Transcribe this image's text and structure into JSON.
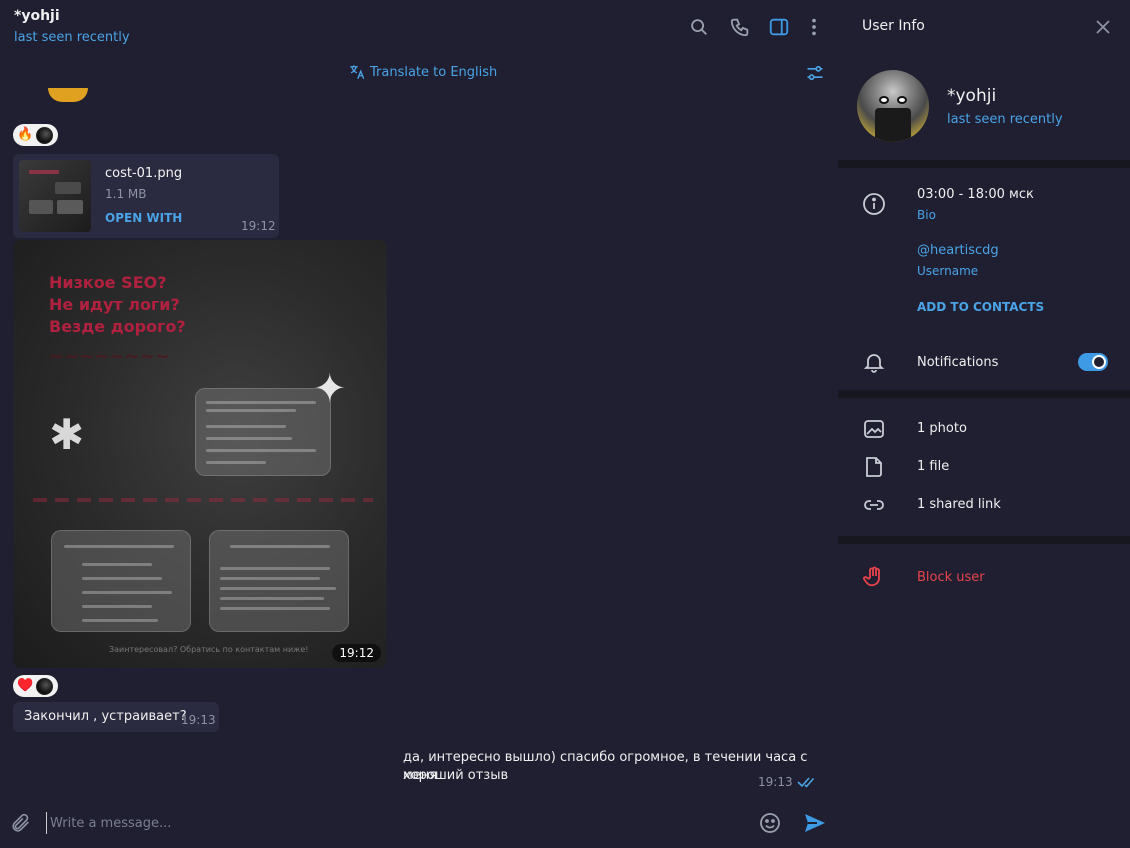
{
  "chat": {
    "title": "*yohji",
    "status": "last seen recently",
    "translate_label": "Translate to English",
    "header_icons": [
      "search-icon",
      "phone-icon",
      "sidebar-toggle-icon",
      "more-vertical-icon"
    ]
  },
  "messages": {
    "reaction1_emoji": "🔥",
    "file": {
      "name": "cost-01.png",
      "size": "1.1 MB",
      "action": "OPEN WITH",
      "time": "19:12"
    },
    "photo": {
      "time": "19:12",
      "headline": "Низкое SEO?\nНе идут логи?\nВезде дорого?",
      "footer": "Заинтересовал? Обратись по контактам ниже!"
    },
    "reaction2_emoji": "♥️",
    "incoming_text": "Закончил , устраивает?",
    "incoming_time": "19:13",
    "outgoing_text_line1": "да, интересно вышло) спасибо огромное, в течении часа с меня",
    "outgoing_text_line2": "хороший отзыв",
    "outgoing_time": "19:13"
  },
  "composer": {
    "placeholder": "Write a message..."
  },
  "info": {
    "title": "User Info",
    "name": "*yohji",
    "status": "last seen recently",
    "bio_value": "03:00 - 18:00 мск",
    "bio_label": "Bio",
    "username_value": "@heartiscdg",
    "username_label": "Username",
    "add_contacts": "ADD TO CONTACTS",
    "notifications_label": "Notifications",
    "notifications_on": true,
    "media_photos": "1 photo",
    "media_files": "1 file",
    "media_links": "1 shared link",
    "block_label": "Block user"
  },
  "colors": {
    "accent": "#4aa3e6",
    "danger": "#e8434c",
    "chat_bg": "#1f1f31",
    "bubble": "#2a2a40"
  }
}
